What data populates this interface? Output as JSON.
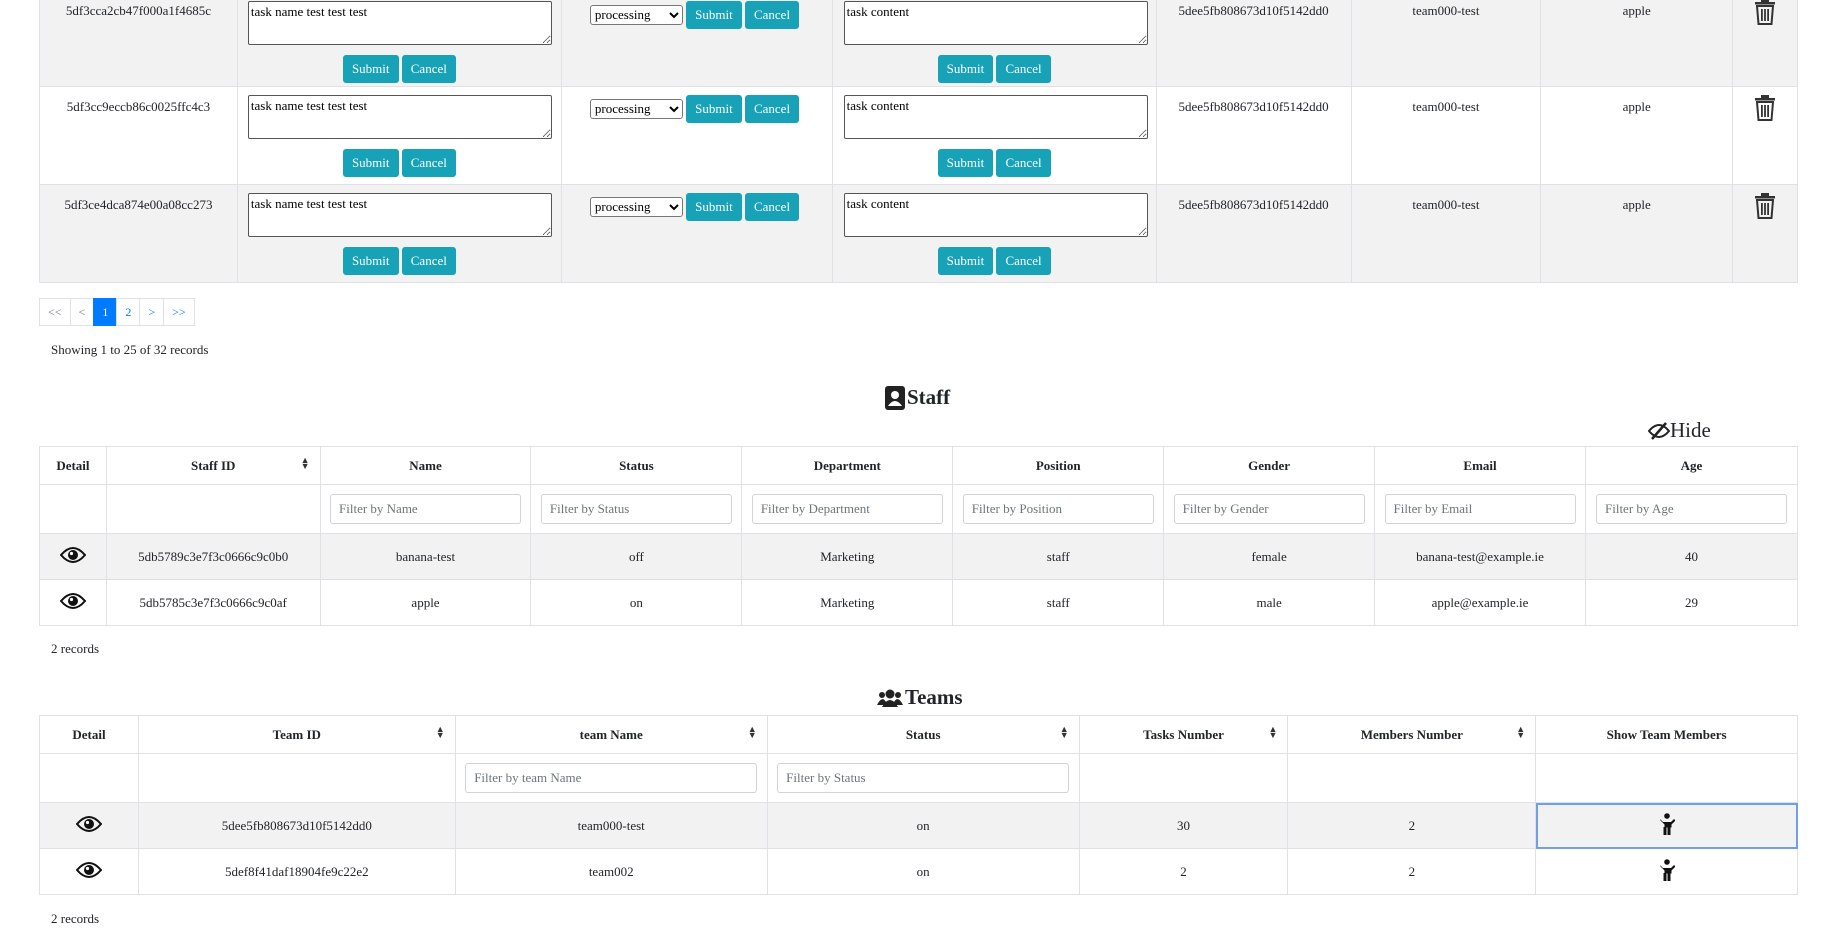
{
  "tasks": {
    "rows": [
      {
        "id": "5df3cca2cb47f000a1f4685c",
        "name": "task name test test test",
        "status": "processing",
        "content": "task content",
        "team_id": "5dee5fb808673d10f5142dd0",
        "team": "team000-test",
        "member": "apple"
      },
      {
        "id": "5df3cc9eccb86c0025ffc4c3",
        "name": "task name test test test",
        "status": "processing",
        "content": "task content",
        "team_id": "5dee5fb808673d10f5142dd0",
        "team": "team000-test",
        "member": "apple"
      },
      {
        "id": "5df3ce4dca874e00a08cc273",
        "name": "task name test test test",
        "status": "processing",
        "content": "task content",
        "team_id": "5dee5fb808673d10f5142dd0",
        "team": "team000-test",
        "member": "apple"
      }
    ],
    "submit_label": "Submit",
    "cancel_label": "Cancel",
    "pagination": {
      "first": "<<",
      "prev": "<",
      "pages": [
        "1",
        "2"
      ],
      "next": ">",
      "last": ">>"
    },
    "records_text": "Showing 1 to 25 of 32 records"
  },
  "staff": {
    "title": "Staff",
    "hide_label": "Hide",
    "headers": [
      "Detail",
      "Staff ID",
      "Name",
      "Status",
      "Department",
      "Position",
      "Gender",
      "Email",
      "Age"
    ],
    "filters": [
      "Filter by Name",
      "Filter by Status",
      "Filter by Department",
      "Filter by Position",
      "Filter by Gender",
      "Filter by Email",
      "Filter by Age"
    ],
    "rows": [
      {
        "id": "5db5789c3e7f3c0666c9c0b0",
        "name": "banana-test",
        "status": "off",
        "department": "Marketing",
        "position": "staff",
        "gender": "female",
        "email": "banana-test@example.ie",
        "age": "40"
      },
      {
        "id": "5db5785c3e7f3c0666c9c0af",
        "name": "apple",
        "status": "on",
        "department": "Marketing",
        "position": "staff",
        "gender": "male",
        "email": "apple@example.ie",
        "age": "29"
      }
    ],
    "records_text": "2 records"
  },
  "teams": {
    "title": "Teams",
    "headers": [
      "Detail",
      "Team ID",
      "team Name",
      "Status",
      "Tasks Number",
      "Members Number",
      "Show Team Members"
    ],
    "filters": [
      "Filter by team Name",
      "Filter by Status"
    ],
    "rows": [
      {
        "id": "5dee5fb808673d10f5142dd0",
        "name": "team000-test",
        "status": "on",
        "tasks": "30",
        "members": "2"
      },
      {
        "id": "5def8f41daf18904fe9c22e2",
        "name": "team002",
        "status": "on",
        "tasks": "2",
        "members": "2"
      }
    ],
    "records_text": "2 records"
  },
  "colors": {
    "accent": "#17a2b8",
    "primary": "#007bff",
    "row_gray": "#f2f2f2"
  }
}
